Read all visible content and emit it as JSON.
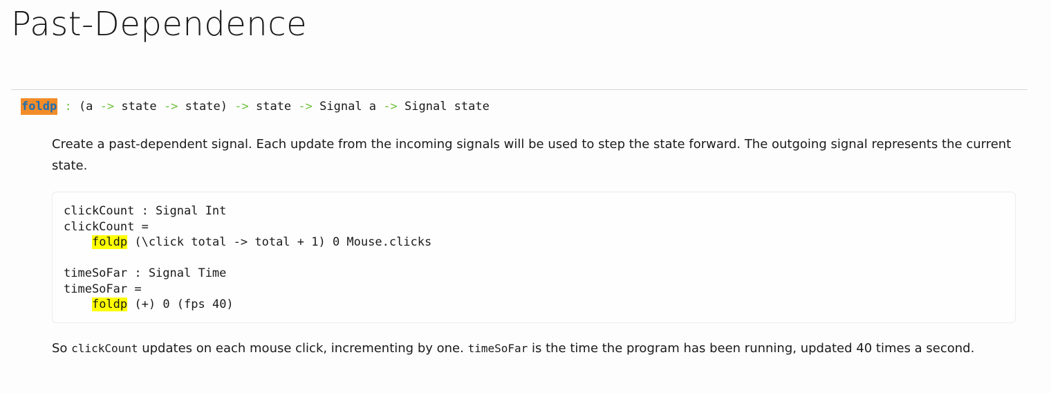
{
  "page": {
    "title": "Past-Dependence"
  },
  "signature": {
    "name": "foldp",
    "colon": ":",
    "parts": [
      "(a",
      "->",
      "state",
      "->",
      "state)",
      "->",
      "state",
      "->",
      "Signal a",
      "->",
      "Signal state"
    ]
  },
  "description": "Create a past-dependent signal. Each update from the incoming signals will be used to step the state forward. The outgoing signal represents the current state.",
  "code_example": {
    "line1": "clickCount : Signal Int",
    "line2": "clickCount =",
    "line3_indent": "    ",
    "line3_hl": "foldp",
    "line3_rest": " (\\click total -> total + 1) 0 Mouse.clicks",
    "line5": "timeSoFar : Signal Time",
    "line6": "timeSoFar =",
    "line7_indent": "    ",
    "line7_hl": "foldp",
    "line7_rest": " (+) 0 (fps 40)"
  },
  "explanation": {
    "t1": "So ",
    "c1": "clickCount",
    "t2": " updates on each mouse click, incrementing by one. ",
    "c2": "timeSoFar",
    "t3": " is the time the program has been running, updated 40 times a second."
  },
  "colors": {
    "name_bg": "#f28c28",
    "name_fg": "#1f6fb2",
    "arrow": "#6ec13a",
    "highlight": "#ffff00"
  }
}
